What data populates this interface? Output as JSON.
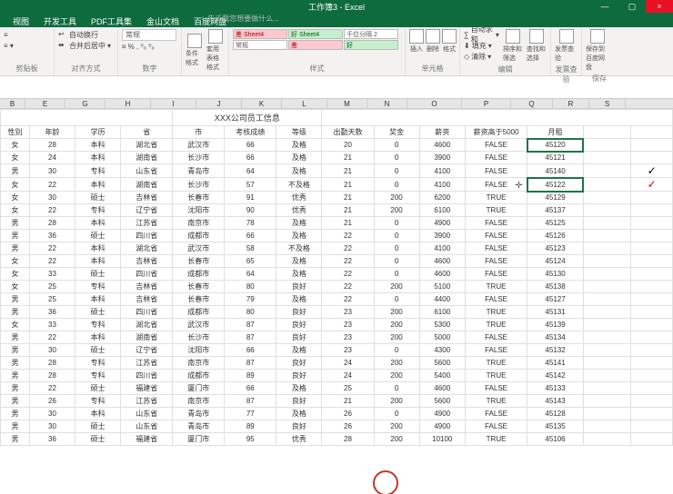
{
  "window": {
    "title": "工作簿3 - Excel",
    "min": "—",
    "max": "▢",
    "close": "×"
  },
  "tabs": [
    "视图",
    "开发工具",
    "PDF工具集",
    "金山文档",
    "百度网盘"
  ],
  "tell": "♀ 告诉我您想要做什么...",
  "ribbon": {
    "clipboard_name": "剪贴板",
    "wrap": "自动换行",
    "merge": "合并后居中",
    "align_name": "对齐方式",
    "num_fmt": "常规",
    "num_name": "数字",
    "cond_fmt": "条件格式",
    "tbl_fmt": "套用表格格式",
    "styles_name": "样式",
    "style_bad": "差 Sheet4",
    "style_good": "好 Sheet4",
    "style_sep": "千位分隔 2",
    "style_norm": "常规",
    "style_cbad": "差",
    "style_cgood": "好",
    "ins": "插入",
    "del": "删除",
    "fmt": "格式",
    "cells_name": "单元格",
    "autosum": "自动求和",
    "fill": "填充",
    "clear": "清除",
    "sortfilter": "排序和筛选",
    "findsel": "查找和选择",
    "edit_name": "编辑",
    "share": "发票查验",
    "save": "保存到百度网盘",
    "share_grp": "发票查验",
    "save_grp": "保存"
  },
  "sheet": {
    "cols": [
      "B",
      "E",
      "G",
      "H",
      "I",
      "J",
      "K",
      "L",
      "M",
      "N",
      "O",
      "P",
      "Q",
      "R",
      "S"
    ],
    "title_merged": "XXX公司员工信息",
    "headers": [
      "性别",
      "年龄",
      "学历",
      "省",
      "市",
      "考核成绩",
      "等级",
      "出勤天数",
      "奖金",
      "薪资",
      "薪资高于5000",
      "月租",
      "",
      ""
    ],
    "rows": [
      [
        "女",
        "28",
        "本科",
        "湖北省",
        "武汉市",
        "66",
        "及格",
        "20",
        "0",
        "4600",
        "FALSE",
        "45120",
        "",
        ""
      ],
      [
        "女",
        "24",
        "本科",
        "湖南省",
        "长沙市",
        "66",
        "及格",
        "21",
        "0",
        "3900",
        "FALSE",
        "45121",
        "",
        ""
      ],
      [
        "男",
        "30",
        "专科",
        "山东省",
        "青岛市",
        "64",
        "及格",
        "21",
        "0",
        "4100",
        "FALSE",
        "45140",
        "",
        "✓"
      ],
      [
        "女",
        "22",
        "本科",
        "湖南省",
        "长沙市",
        "57",
        "不及格",
        "21",
        "0",
        "4100",
        "FALSE",
        "45122",
        "",
        "✓r"
      ],
      [
        "女",
        "30",
        "硕士",
        "吉林省",
        "长春市",
        "91",
        "优秀",
        "21",
        "200",
        "6200",
        "TRUE",
        "45129",
        "",
        ""
      ],
      [
        "女",
        "22",
        "专科",
        "辽宁省",
        "沈阳市",
        "90",
        "优秀",
        "21",
        "200",
        "6100",
        "TRUE",
        "45137",
        "",
        ""
      ],
      [
        "男",
        "28",
        "本科",
        "江苏省",
        "南京市",
        "78",
        "及格",
        "21",
        "0",
        "4900",
        "FALSE",
        "45125",
        "",
        ""
      ],
      [
        "男",
        "36",
        "硕士",
        "四川省",
        "成都市",
        "66",
        "及格",
        "22",
        "0",
        "3900",
        "FALSE",
        "45126",
        "",
        ""
      ],
      [
        "男",
        "22",
        "本科",
        "湖北省",
        "武汉市",
        "58",
        "不及格",
        "22",
        "0",
        "4100",
        "FALSE",
        "45123",
        "",
        ""
      ],
      [
        "女",
        "22",
        "本科",
        "吉林省",
        "长春市",
        "65",
        "及格",
        "22",
        "0",
        "4600",
        "FALSE",
        "45124",
        "",
        ""
      ],
      [
        "女",
        "33",
        "硕士",
        "四川省",
        "成都市",
        "64",
        "及格",
        "22",
        "0",
        "4600",
        "FALSE",
        "45130",
        "",
        ""
      ],
      [
        "女",
        "25",
        "专科",
        "吉林省",
        "长春市",
        "80",
        "良好",
        "22",
        "200",
        "5100",
        "TRUE",
        "45138",
        "",
        ""
      ],
      [
        "男",
        "25",
        "本科",
        "吉林省",
        "长春市",
        "79",
        "及格",
        "22",
        "0",
        "4400",
        "FALSE",
        "45127",
        "",
        ""
      ],
      [
        "男",
        "36",
        "硕士",
        "四川省",
        "成都市",
        "80",
        "良好",
        "23",
        "200",
        "6100",
        "TRUE",
        "45131",
        "",
        ""
      ],
      [
        "女",
        "33",
        "专科",
        "湖北省",
        "武汉市",
        "87",
        "良好",
        "23",
        "200",
        "5300",
        "TRUE",
        "45139",
        "",
        ""
      ],
      [
        "男",
        "22",
        "本科",
        "湖南省",
        "长沙市",
        "87",
        "良好",
        "23",
        "200",
        "5000",
        "FALSE",
        "45134",
        "",
        ""
      ],
      [
        "男",
        "30",
        "硕士",
        "辽宁省",
        "沈阳市",
        "66",
        "及格",
        "23",
        "0",
        "4300",
        "FALSE",
        "45132",
        "",
        ""
      ],
      [
        "男",
        "28",
        "专科",
        "江苏省",
        "南京市",
        "87",
        "良好",
        "24",
        "200",
        "5600",
        "TRUE",
        "45141",
        "",
        ""
      ],
      [
        "男",
        "28",
        "专科",
        "四川省",
        "成都市",
        "89",
        "良好",
        "24",
        "200",
        "5400",
        "TRUE",
        "45142",
        "",
        ""
      ],
      [
        "男",
        "22",
        "硕士",
        "福建省",
        "厦门市",
        "66",
        "及格",
        "25",
        "0",
        "4600",
        "FALSE",
        "45133",
        "",
        ""
      ],
      [
        "男",
        "26",
        "专科",
        "江苏省",
        "南京市",
        "87",
        "良好",
        "21",
        "200",
        "5600",
        "TRUE",
        "45143",
        "",
        ""
      ],
      [
        "男",
        "30",
        "本科",
        "山东省",
        "青岛市",
        "77",
        "及格",
        "26",
        "0",
        "4900",
        "FALSE",
        "45128",
        "",
        ""
      ],
      [
        "男",
        "30",
        "硕士",
        "山东省",
        "青岛市",
        "89",
        "良好",
        "26",
        "200",
        "4900",
        "FALSE",
        "45135",
        "",
        ""
      ],
      [
        "男",
        "36",
        "硕士",
        "福建省",
        "厦门市",
        "95",
        "优秀",
        "28",
        "200",
        "10100",
        "TRUE",
        "45106",
        "",
        ""
      ]
    ],
    "selected_row": 3,
    "selected_col": 11
  }
}
